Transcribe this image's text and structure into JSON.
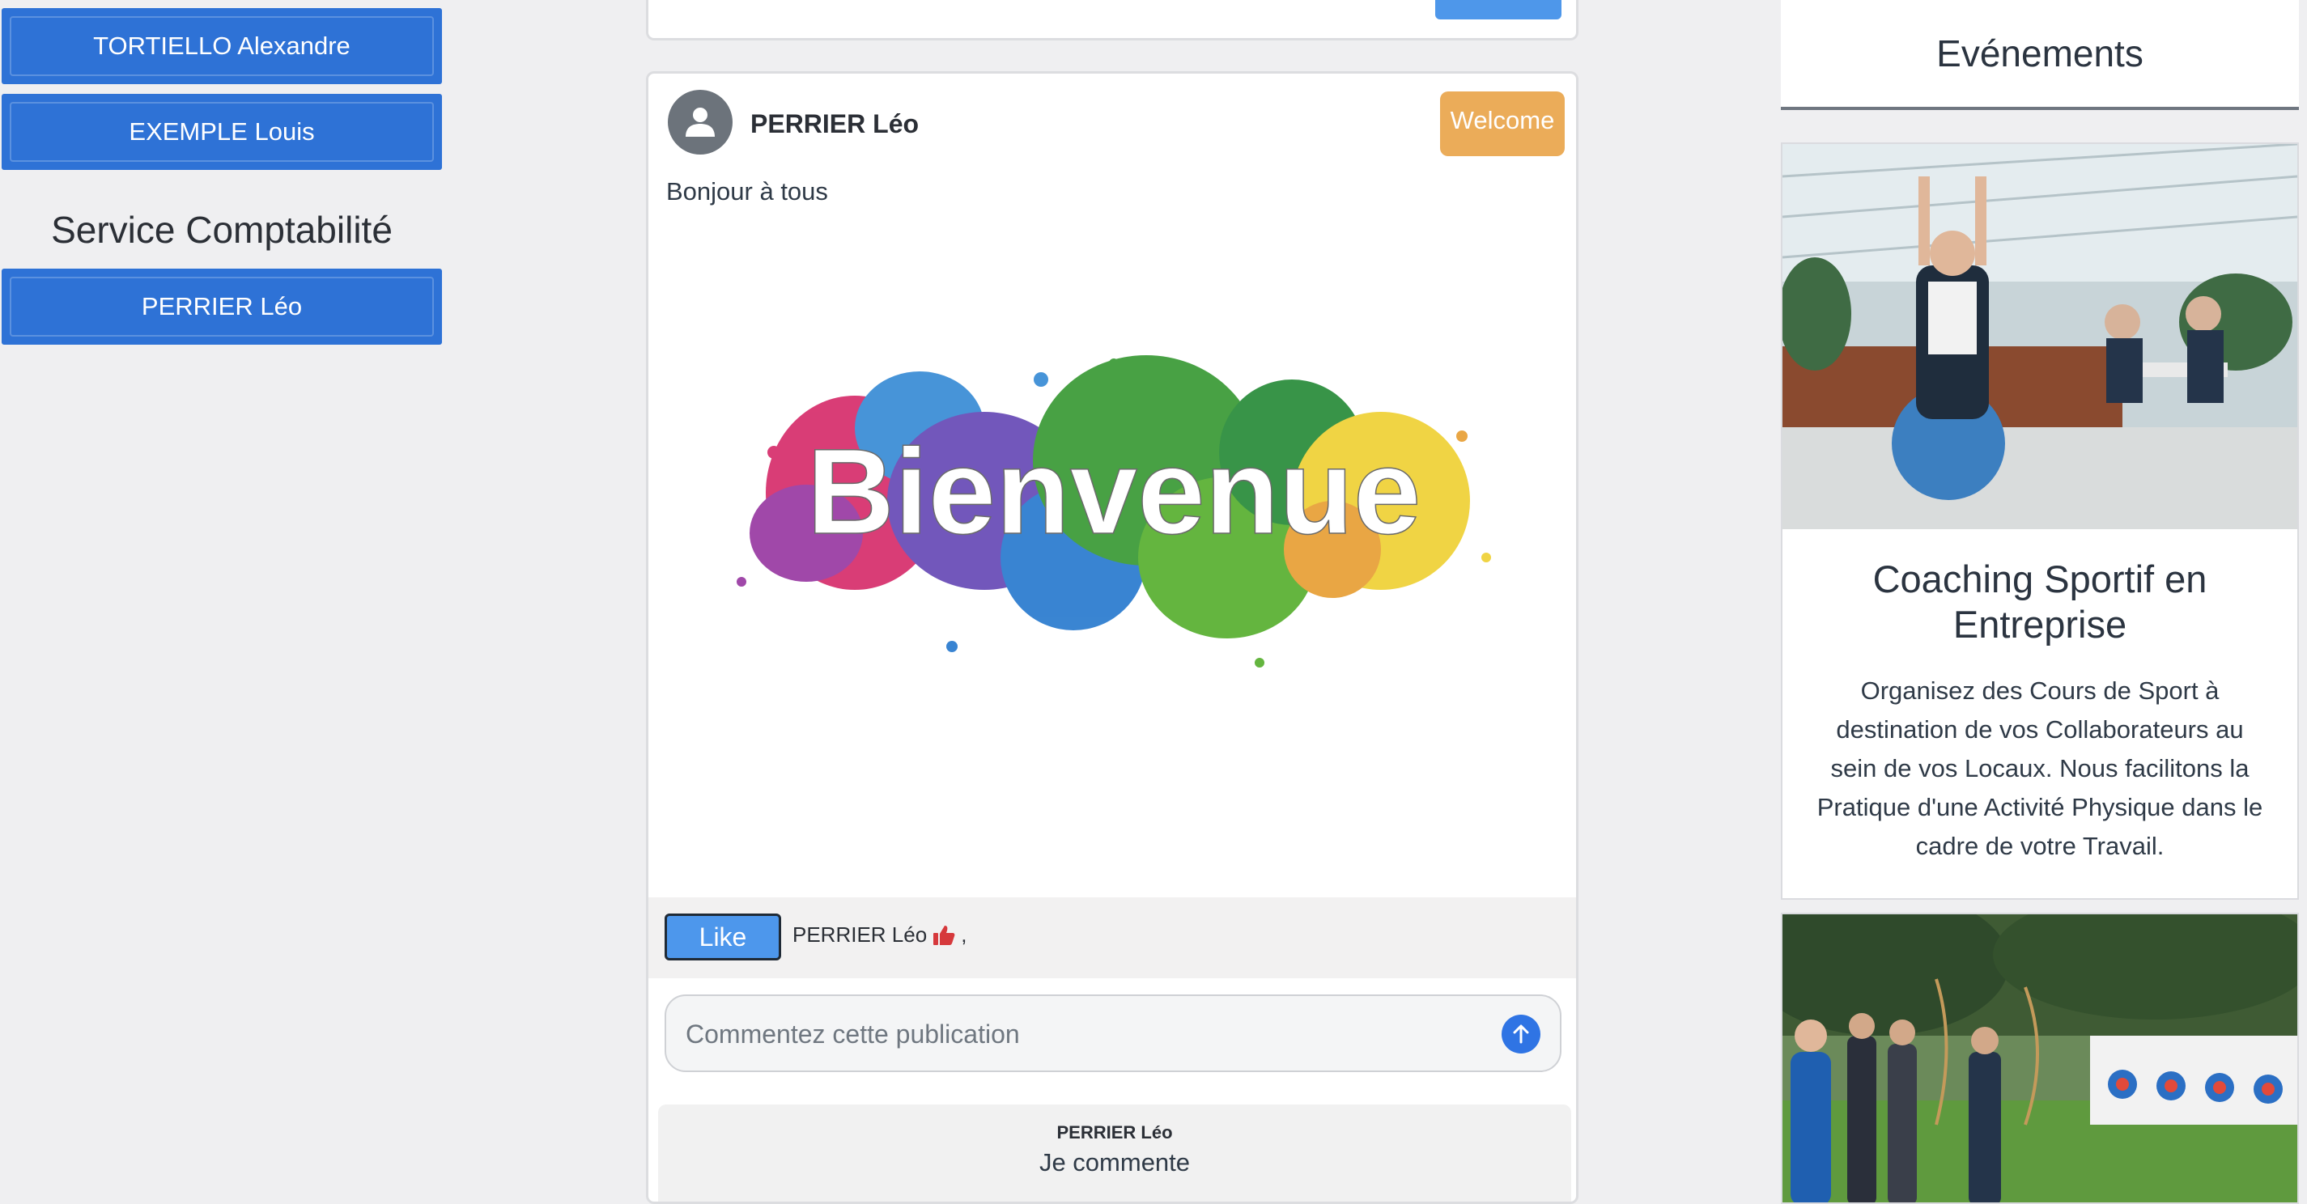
{
  "sidebar": {
    "people_top": [
      {
        "label": "TORTIELLO Alexandre"
      },
      {
        "label": "EXEMPLE Louis"
      }
    ],
    "department": {
      "title": "Service Comptabilité",
      "people": [
        {
          "label": "PERRIER Léo"
        }
      ]
    }
  },
  "post": {
    "author": "PERRIER Léo",
    "tag": "Welcome",
    "text": "Bonjour à tous",
    "image_text": "Bienvenue",
    "like_label": "Like",
    "likers": "PERRIER Léo",
    "likers_suffix": ",",
    "comment_placeholder": "Commentez cette publication",
    "comments": [
      {
        "author": "PERRIER Léo",
        "text": "Je commente"
      }
    ]
  },
  "events": {
    "header": "Evénements",
    "items": [
      {
        "title": "Coaching Sportif en Entreprise",
        "description": "Organisez des Cours de Sport à destination de vos Collaborateurs au sein de vos Locaux. Nous facilitons la Pratique d'une Activité Physique dans le cadre de votre Travail."
      }
    ]
  },
  "colors": {
    "primary": "#2e72d6",
    "badge": "#ebac59",
    "like": "#4d97ec",
    "send": "#2f74e4"
  },
  "icons": [
    "user-icon",
    "thumbs-up-icon",
    "arrow-up-icon"
  ]
}
